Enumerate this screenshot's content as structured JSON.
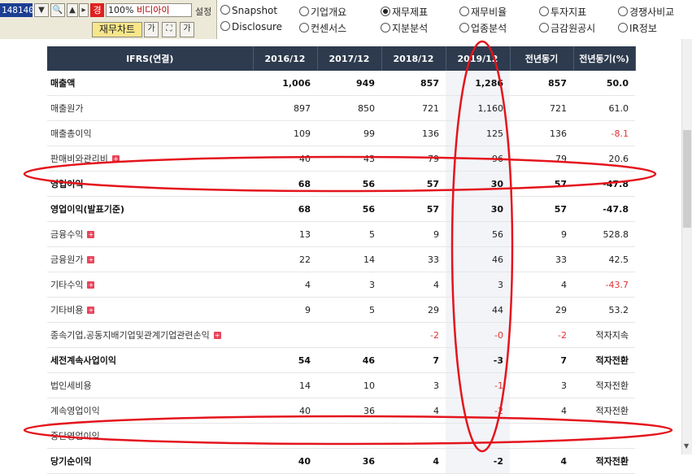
{
  "toolbar": {
    "stock_code": "148140",
    "badge_label": "경",
    "zoom_text": "100%",
    "company_name": "비디아이",
    "settings_label": "설정",
    "fin_chart_label": "재무차트",
    "size_btn_label": "가",
    "font_btn_label": "가"
  },
  "tabs": [
    {
      "label": "Snapshot",
      "selected": false
    },
    {
      "label": "기업개요",
      "selected": false
    },
    {
      "label": "재무제표",
      "selected": true
    },
    {
      "label": "재무비율",
      "selected": false
    },
    {
      "label": "투자지표",
      "selected": false
    },
    {
      "label": "경쟁사비교",
      "selected": false
    },
    {
      "label": "Disclosure",
      "selected": false
    },
    {
      "label": "컨센서스",
      "selected": false
    },
    {
      "label": "지분분석",
      "selected": false
    },
    {
      "label": "업종분석",
      "selected": false
    },
    {
      "label": "금감원공시",
      "selected": false
    },
    {
      "label": "IR정보",
      "selected": false
    }
  ],
  "table": {
    "headers": [
      "IFRS(연결)",
      "2016/12",
      "2017/12",
      "2018/12",
      "2019/12",
      "전년동기",
      "전년동기(%)"
    ],
    "rows": [
      {
        "label": "매출액",
        "bold": true,
        "expand": false,
        "values": [
          "1,006",
          "949",
          "857",
          "1,286",
          "857",
          "50.0"
        ]
      },
      {
        "label": "매출원가",
        "bold": false,
        "expand": false,
        "values": [
          "897",
          "850",
          "721",
          "1,160",
          "721",
          "61.0"
        ]
      },
      {
        "label": "매출총이익",
        "bold": false,
        "expand": false,
        "values": [
          "109",
          "99",
          "136",
          "125",
          "136",
          "-8.1"
        ]
      },
      {
        "label": "판매비와관리비",
        "bold": false,
        "expand": true,
        "values": [
          "40",
          "43",
          "79",
          "96",
          "79",
          "20.6"
        ]
      },
      {
        "label": "영업이익",
        "bold": true,
        "expand": false,
        "values": [
          "68",
          "56",
          "57",
          "30",
          "57",
          "-47.8"
        ]
      },
      {
        "label": "영업이익(발표기준)",
        "bold": true,
        "expand": false,
        "values": [
          "68",
          "56",
          "57",
          "30",
          "57",
          "-47.8"
        ]
      },
      {
        "label": "금융수익",
        "bold": false,
        "expand": true,
        "values": [
          "13",
          "5",
          "9",
          "56",
          "9",
          "528.8"
        ]
      },
      {
        "label": "금융원가",
        "bold": false,
        "expand": true,
        "values": [
          "22",
          "14",
          "33",
          "46",
          "33",
          "42.5"
        ]
      },
      {
        "label": "기타수익",
        "bold": false,
        "expand": true,
        "values": [
          "4",
          "3",
          "4",
          "3",
          "4",
          "-43.7"
        ]
      },
      {
        "label": "기타비용",
        "bold": false,
        "expand": true,
        "values": [
          "9",
          "5",
          "29",
          "44",
          "29",
          "53.2"
        ]
      },
      {
        "label": "종속기업,공동지배기업및관계기업관련손익",
        "bold": false,
        "expand": true,
        "values": [
          "",
          "",
          "-2",
          "-0",
          "-2",
          "적자지속"
        ]
      },
      {
        "label": "세전계속사업이익",
        "bold": true,
        "expand": false,
        "values": [
          "54",
          "46",
          "7",
          "-3",
          "7",
          "적자전환"
        ]
      },
      {
        "label": "법인세비용",
        "bold": false,
        "expand": false,
        "values": [
          "14",
          "10",
          "3",
          "-1",
          "3",
          "적자전환"
        ]
      },
      {
        "label": "계속영업이익",
        "bold": false,
        "expand": false,
        "values": [
          "40",
          "36",
          "4",
          "-2",
          "4",
          "적자전환"
        ]
      },
      {
        "label": "중단영업이익",
        "bold": false,
        "expand": false,
        "values": [
          "",
          "",
          "",
          "",
          "",
          ""
        ]
      },
      {
        "label": "당기순이익",
        "bold": true,
        "expand": false,
        "values": [
          "40",
          "36",
          "4",
          "-2",
          "4",
          "적자전환"
        ]
      }
    ]
  },
  "annotation_color": "#e4141c"
}
